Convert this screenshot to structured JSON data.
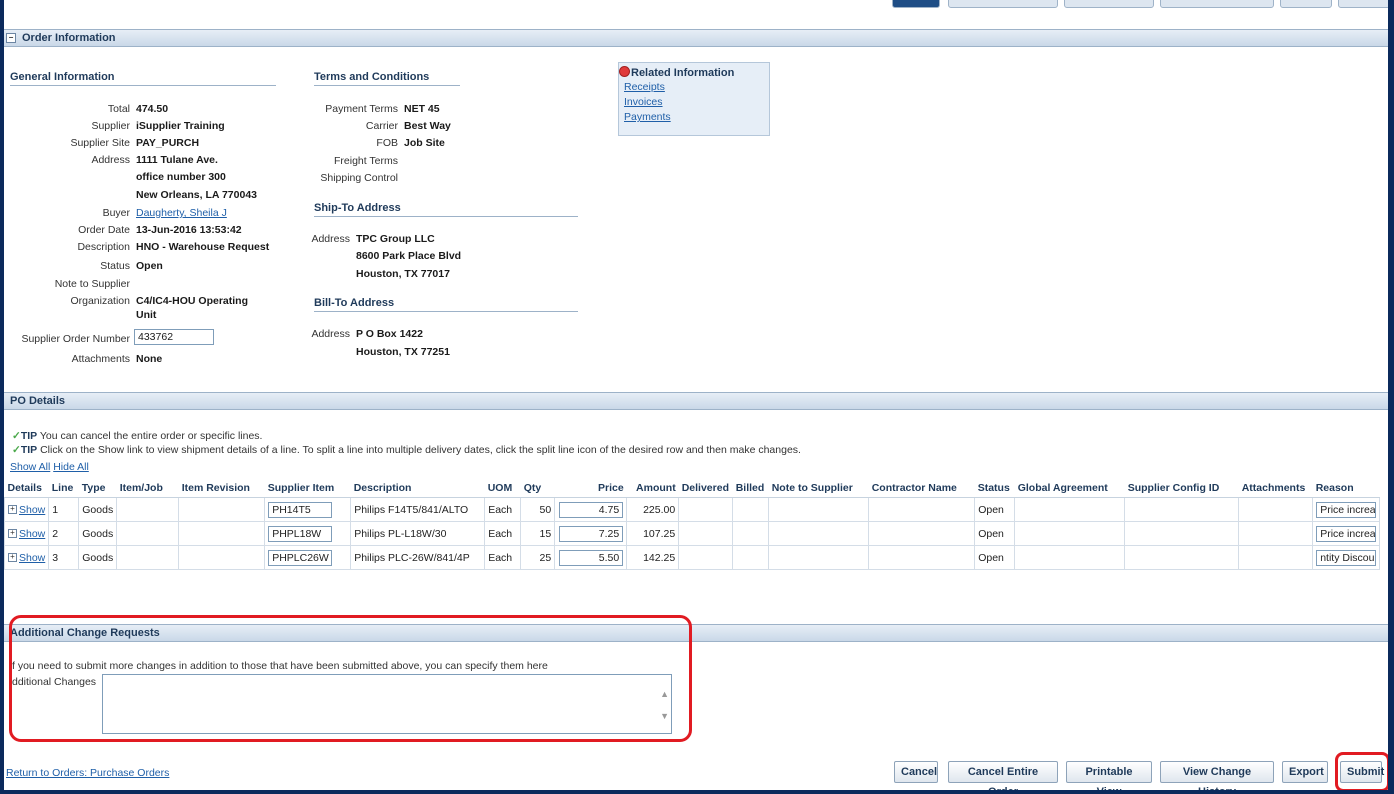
{
  "order_info": {
    "section_title": "Order Information",
    "general": {
      "title": "General Information",
      "total_label": "Total",
      "total": "474.50",
      "supplier_label": "Supplier",
      "supplier": "iSupplier Training",
      "supplier_site_label": "Supplier Site",
      "supplier_site": "PAY_PURCH",
      "address_label": "Address",
      "address_line1": "1111 Tulane Ave.",
      "address_line2": "office number 300",
      "address_line3": "New Orleans, LA 770043",
      "buyer_label": "Buyer",
      "buyer": "Daugherty, Sheila J",
      "order_date_label": "Order Date",
      "order_date": "13-Jun-2016 13:53:42",
      "description_label": "Description",
      "description": "HNO - Warehouse Request",
      "status_label": "Status",
      "status": "Open",
      "note_label": "Note to Supplier",
      "organization_label": "Organization",
      "organization_line1": "C4/IC4-HOU Operating",
      "organization_line2": "Unit",
      "supplier_order_number_label": "Supplier Order Number",
      "supplier_order_number": "433762",
      "attachments_label": "Attachments",
      "attachments": "None"
    },
    "terms": {
      "title": "Terms and Conditions",
      "payment_terms_label": "Payment Terms",
      "payment_terms": "NET 45",
      "carrier_label": "Carrier",
      "carrier": "Best Way",
      "fob_label": "FOB",
      "fob": "Job Site",
      "freight_terms_label": "Freight Terms",
      "shipping_control_label": "Shipping Control"
    },
    "ship_to": {
      "title": "Ship-To Address",
      "address_label": "Address",
      "line1": "TPC Group LLC",
      "line2": "8600 Park Place Blvd",
      "line3": "Houston, TX 77017"
    },
    "bill_to": {
      "title": "Bill-To Address",
      "address_label": "Address",
      "line1": "P O Box 1422",
      "line2": "Houston, TX 77251"
    },
    "related": {
      "title": "Related Information",
      "items": [
        "Receipts",
        "Invoices",
        "Payments"
      ]
    }
  },
  "po_details": {
    "section_title": "PO Details",
    "tip_label": "TIP",
    "tip1": "You can cancel the entire order or specific lines.",
    "tip2": "Click on the Show link to view shipment details of a line. To split a line into multiple delivery dates, click the split line icon of the desired row and then make changes.",
    "show_all": "Show All",
    "hide_all": "Hide All",
    "columns": [
      "Details",
      "Line",
      "Type",
      "Item/Job",
      "Item Revision",
      "Supplier Item",
      "Description",
      "UOM",
      "Qty",
      "Price",
      "Amount",
      "Delivered",
      "Billed",
      "Note to Supplier",
      "Contractor Name",
      "Status",
      "Global Agreement",
      "Supplier Config ID",
      "Attachments",
      "Reason"
    ],
    "rows": [
      {
        "details": "Show",
        "line": "1",
        "type": "Goods",
        "supplier_item": "PH14T5",
        "description": "Philips F14T5/841/ALTO",
        "uom": "Each",
        "qty": "50",
        "price": "4.75",
        "amount": "225.00",
        "status": "Open",
        "reason": "Price increase"
      },
      {
        "details": "Show",
        "line": "2",
        "type": "Goods",
        "supplier_item": "PHPL18W",
        "description": "Philips PL-L18W/30",
        "uom": "Each",
        "qty": "15",
        "price": "7.25",
        "amount": "107.25",
        "status": "Open",
        "reason": "Price increase"
      },
      {
        "details": "Show",
        "line": "3",
        "type": "Goods",
        "supplier_item": "PHPLC26W",
        "description": "Philips PLC-26W/841/4P",
        "uom": "Each",
        "qty": "25",
        "price": "5.50",
        "amount": "142.25",
        "status": "Open",
        "reason": "ntity Discount"
      }
    ]
  },
  "additional": {
    "section_title": "Additional Change Requests",
    "instructions": "f you need to submit more changes in addition to those that have been submitted above, you can specify them here",
    "field_label": "dditional Changes",
    "value": ""
  },
  "footer": {
    "return_link": "Return to Orders: Purchase Orders",
    "buttons": {
      "cancel": "Cancel",
      "cancel_entire": "Cancel Entire Order",
      "printable": "Printable View",
      "history": "View Change History",
      "export": "Export",
      "submit": "Submit"
    }
  },
  "colors": {
    "frame": "#0b2a5c",
    "section_bar": "#c9d8e8",
    "heading": "#1f3a5a",
    "link": "#1f5fa8",
    "highlight": "#e11b22"
  }
}
